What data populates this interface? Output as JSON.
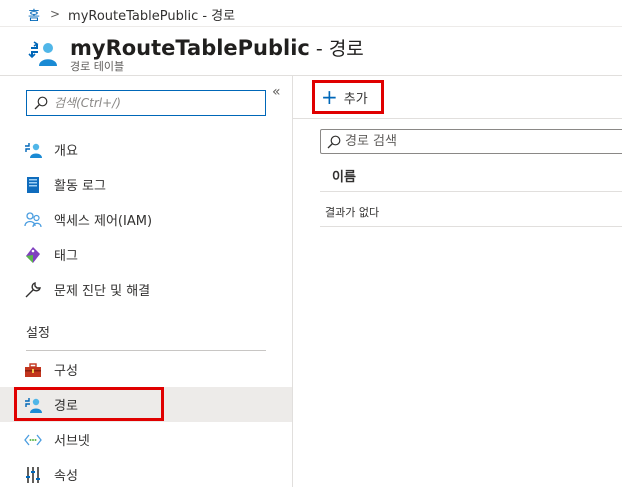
{
  "breadcrumb": {
    "home": "홈",
    "separator": ">",
    "current": "myRouteTablePublic - 경로"
  },
  "header": {
    "title": "myRouteTablePublic",
    "title_suffix": " - 경로",
    "subtitle": "경로 테이블",
    "icon": "route-table-icon"
  },
  "sidebar": {
    "search_placeholder": "검색(Ctrl+/)",
    "collapse_label": "«",
    "items": [
      {
        "label": "개요",
        "icon": "overview-icon"
      },
      {
        "label": "활동 로그",
        "icon": "activity-log-icon"
      },
      {
        "label": "액세스 제어(IAM)",
        "icon": "access-control-icon"
      },
      {
        "label": "태그",
        "icon": "tag-icon"
      },
      {
        "label": "문제 진단 및 해결",
        "icon": "wrench-icon"
      }
    ],
    "section_title": "설정",
    "settings_items": [
      {
        "label": "구성",
        "icon": "toolbox-icon"
      },
      {
        "label": "경로",
        "icon": "route-icon",
        "active": true
      },
      {
        "label": "서브넷",
        "icon": "subnet-icon"
      },
      {
        "label": "속성",
        "icon": "properties-icon"
      }
    ]
  },
  "toolbar": {
    "add_label": "추가",
    "add_icon": "plus-icon"
  },
  "content": {
    "search_placeholder": "경로 검색",
    "column_name": "이름",
    "empty_message": "결과가 없다"
  },
  "colors": {
    "accent": "#0067b8",
    "highlight": "#e00000",
    "active_bg": "#edebe9"
  }
}
